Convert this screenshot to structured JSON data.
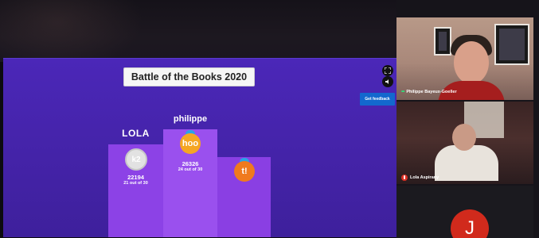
{
  "quiz": {
    "title": "Battle of the Books 2020",
    "feedback_label": "Get feedback",
    "controls": {
      "fullscreen_icon": "expand-icon",
      "sound_icon": "speaker-icon"
    },
    "colors": {
      "background": "#4b27b8",
      "podium": "#8c42e6",
      "button": "#1368ce"
    },
    "podium": [
      {
        "rank": 1,
        "name": "LOLA",
        "avatar": "k2",
        "score": "22194",
        "detail": "21 out of 30"
      },
      {
        "rank": 2,
        "name": "philippe",
        "avatar": "hoo",
        "score": "26326",
        "detail": "24 out of 30"
      },
      {
        "rank": 3,
        "name": "",
        "avatar": "t!",
        "score": "",
        "detail": ""
      }
    ]
  },
  "participants": [
    {
      "name": "Philippe Bayeux-Goeller",
      "mic": "active"
    },
    {
      "name": "Lola Aspirany",
      "mic": "muted"
    },
    {
      "initial": "J",
      "color": "#d12a1c"
    }
  ]
}
